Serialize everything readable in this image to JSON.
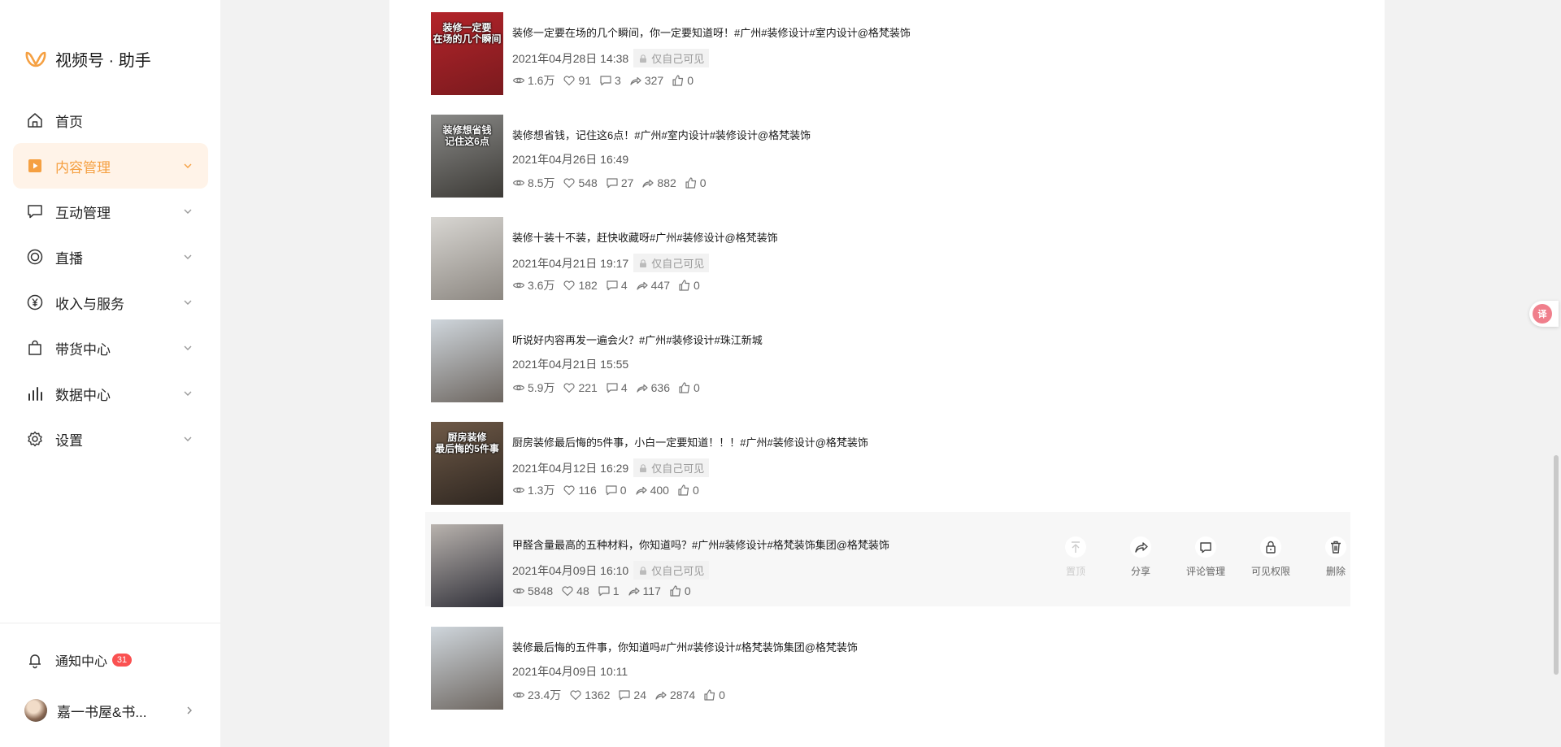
{
  "app": {
    "brand": "视频号 · 助手"
  },
  "sidebar": {
    "items": [
      {
        "label": "首页",
        "icon": "home-icon",
        "has_arrow": false
      },
      {
        "label": "内容管理",
        "icon": "play-square-icon",
        "has_arrow": true,
        "active": true
      },
      {
        "label": "互动管理",
        "icon": "comment-icon",
        "has_arrow": true
      },
      {
        "label": "直播",
        "icon": "live-icon",
        "has_arrow": true
      },
      {
        "label": "收入与服务",
        "icon": "yuan-icon",
        "has_arrow": true
      },
      {
        "label": "带货中心",
        "icon": "shopping-bag-icon",
        "has_arrow": true
      },
      {
        "label": "数据中心",
        "icon": "bar-chart-icon",
        "has_arrow": true
      },
      {
        "label": "设置",
        "icon": "gear-icon",
        "has_arrow": true
      }
    ],
    "notification": {
      "label": "通知中心",
      "count": "31"
    },
    "profile": {
      "name": "嘉一书屋&书..."
    }
  },
  "colors": {
    "accent": "#f5a042",
    "active_bg": "#fff3e8",
    "badge": "#fa5151"
  },
  "posts": [
    {
      "title": "装修一定要在场的几个瞬间，你一定要知道呀！#广州#装修设计#室内设计@格梵装饰",
      "date": "2021年04月28日 14:38",
      "visibility": "仅自己可见",
      "views": "1.6万",
      "likes": "91",
      "comments": "3",
      "shares": "327",
      "thumbs": "0",
      "thumb_text": "装修一定要\n在场的几个瞬间",
      "thumb_colors": [
        "#b3242a",
        "#7a1a1e"
      ]
    },
    {
      "title": "装修想省钱，记住这6点！#广州#室内设计#装修设计@格梵装饰",
      "date": "2021年04月26日 16:49",
      "visibility": "",
      "views": "8.5万",
      "likes": "548",
      "comments": "27",
      "shares": "882",
      "thumbs": "0",
      "thumb_text": "装修想省钱\n记住这6点",
      "thumb_colors": [
        "#8a8a88",
        "#3c3a36"
      ]
    },
    {
      "title": "装修十装十不装，赶快收藏呀#广州#装修设计@格梵装饰",
      "date": "2021年04月21日 19:17",
      "visibility": "仅自己可见",
      "views": "3.6万",
      "likes": "182",
      "comments": "4",
      "shares": "447",
      "thumbs": "0",
      "thumb_text": "",
      "thumb_colors": [
        "#d8d6d2",
        "#8c8781"
      ]
    },
    {
      "title": "听说好内容再发一遍会火？#广州#装修设计#珠江新城",
      "date": "2021年04月21日 15:55",
      "visibility": "",
      "views": "5.9万",
      "likes": "221",
      "comments": "4",
      "shares": "636",
      "thumbs": "0",
      "thumb_text": "",
      "thumb_colors": [
        "#cfd6dc",
        "#6d6660"
      ]
    },
    {
      "title": "厨房装修最后悔的5件事，小白一定要知道！！！#广州#装修设计@格梵装饰",
      "date": "2021年04月12日 16:29",
      "visibility": "仅自己可见",
      "views": "1.3万",
      "likes": "116",
      "comments": "0",
      "shares": "400",
      "thumbs": "0",
      "thumb_text": "厨房装修\n最后悔的5件事",
      "thumb_colors": [
        "#6f5a48",
        "#2e2620"
      ]
    },
    {
      "title": "甲醛含量最高的五种材料，你知道吗？#广州#装修设计#格梵装饰集团@格梵装饰",
      "date": "2021年04月09日 16:10",
      "visibility": "仅自己可见",
      "views": "5848",
      "likes": "48",
      "comments": "1",
      "shares": "117",
      "thumbs": "0",
      "thumb_text": "",
      "thumb_colors": [
        "#b9b3ae",
        "#2f2f38"
      ],
      "hovered": true
    },
    {
      "title": "装修最后悔的五件事，你知道吗#广州#装修设计#格梵装饰集团@格梵装饰",
      "date": "2021年04月09日 10:11",
      "visibility": "",
      "views": "23.4万",
      "likes": "1362",
      "comments": "24",
      "shares": "2874",
      "thumbs": "0",
      "thumb_text": "",
      "thumb_colors": [
        "#cfd6dc",
        "#6d6660"
      ]
    }
  ],
  "row_actions": [
    {
      "label": "置顶",
      "icon": "pin-top-icon",
      "disabled": true
    },
    {
      "label": "分享",
      "icon": "share-icon",
      "disabled": false
    },
    {
      "label": "评论管理",
      "icon": "comment-manage-icon",
      "disabled": false
    },
    {
      "label": "可见权限",
      "icon": "lock-icon",
      "disabled": false
    },
    {
      "label": "删除",
      "icon": "trash-icon",
      "disabled": false
    }
  ]
}
